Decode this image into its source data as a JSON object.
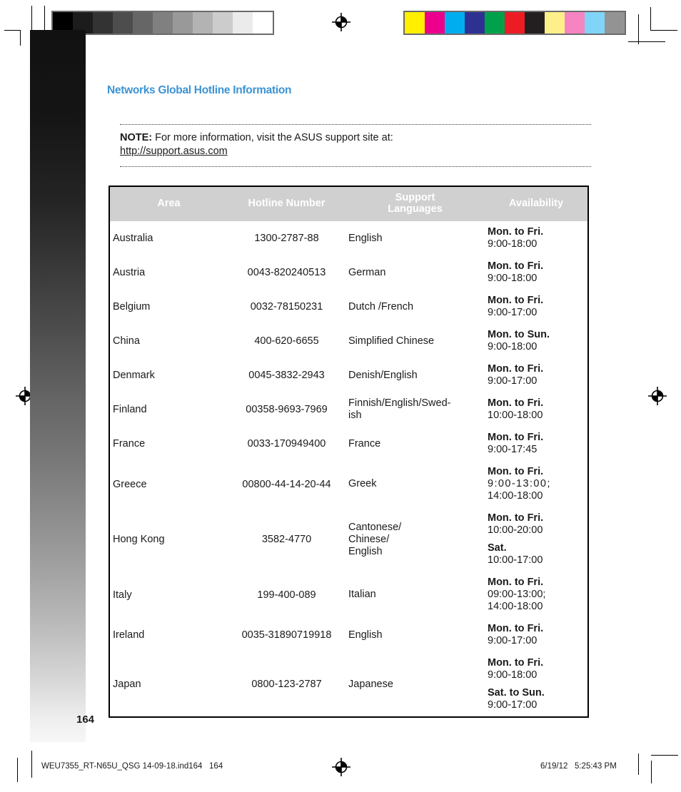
{
  "page": {
    "title": "Networks Global Hotline Information",
    "number": "164",
    "accent_color": "#3c93d4"
  },
  "note": {
    "label": "NOTE:",
    "text": "For more information, visit the ASUS support site at:",
    "url": "http://support.asus.com"
  },
  "table": {
    "headers": {
      "area": "Area",
      "hotline": "Hotline Number",
      "languages_line1": "Support",
      "languages_line2": "Languages",
      "availability": "Availability"
    },
    "rows": [
      {
        "area": "Australia",
        "hotline": "1300-2787-88",
        "languages": [
          "English"
        ],
        "availability": [
          {
            "days": "Mon. to Fri.",
            "hours": "9:00-18:00",
            "spaced": false
          }
        ]
      },
      {
        "area": "Austria",
        "hotline": "0043-820240513",
        "languages": [
          "German"
        ],
        "availability": [
          {
            "days": "Mon. to Fri.",
            "hours": "9:00-18:00",
            "spaced": false
          }
        ]
      },
      {
        "area": "Belgium",
        "hotline": "0032-78150231",
        "languages": [
          "Dutch /French"
        ],
        "availability": [
          {
            "days": "Mon. to Fri.",
            "hours": "9:00-17:00",
            "spaced": false
          }
        ]
      },
      {
        "area": "China",
        "hotline": "400-620-6655",
        "languages": [
          "Simplified Chinese"
        ],
        "availability": [
          {
            "days": "Mon. to Sun.",
            "hours": "9:00-18:00",
            "spaced": false
          }
        ]
      },
      {
        "area": "Denmark",
        "hotline": "0045-3832-2943",
        "languages": [
          "Denish/English"
        ],
        "availability": [
          {
            "days": "Mon. to Fri.",
            "hours": "9:00-17:00",
            "spaced": false
          }
        ]
      },
      {
        "area": "Finland",
        "hotline": "00358-9693-7969",
        "languages": [
          "Finnish/English/Swed-",
          "ish"
        ],
        "availability": [
          {
            "days": "Mon. to Fri.",
            "hours": "10:00-18:00",
            "spaced": false
          }
        ]
      },
      {
        "area": "France",
        "hotline": "0033-170949400",
        "languages": [
          "France"
        ],
        "availability": [
          {
            "days": "Mon. to Fri.",
            "hours": "9:00-17:45",
            "spaced": false
          }
        ]
      },
      {
        "area": "Greece",
        "hotline": "00800-44-14-20-44",
        "languages": [
          "Greek"
        ],
        "availability": [
          {
            "days": "Mon. to Fri.",
            "hours": "9:00-13:00;",
            "spaced": true
          },
          {
            "days": "",
            "hours": "14:00-18:00",
            "spaced": false
          }
        ]
      },
      {
        "area": "Hong Kong",
        "hotline": "3582-4770",
        "languages": [
          "Cantonese/",
          "Chinese/",
          "English"
        ],
        "availability": [
          {
            "days": "Mon. to Fri.",
            "hours": "10:00-20:00",
            "spaced": false
          },
          {
            "days": "Sat.",
            "hours": "10:00-17:00",
            "spaced": false
          }
        ]
      },
      {
        "area": "Italy",
        "hotline": "199-400-089",
        "languages": [
          "Italian"
        ],
        "availability": [
          {
            "days": "Mon. to Fri.",
            "hours": "09:00-13:00;",
            "spaced": false
          },
          {
            "days": "",
            "hours": "14:00-18:00",
            "spaced": false
          }
        ]
      },
      {
        "area": "Ireland",
        "hotline": "0035-31890719918",
        "languages": [
          "English"
        ],
        "availability": [
          {
            "days": "Mon. to Fri.",
            "hours": "9:00-17:00",
            "spaced": false
          }
        ]
      },
      {
        "area": "Japan",
        "hotline": "0800-123-2787",
        "languages": [
          "Japanese"
        ],
        "availability": [
          {
            "days": "Mon. to Fri.",
            "hours": "9:00-18:00",
            "spaced": false
          },
          {
            "days": "Sat. to Sun.",
            "hours": "9:00-17:00",
            "spaced": false
          }
        ]
      }
    ]
  },
  "print_marks": {
    "grayscale_swatches": [
      "#000000",
      "#1c1c1c",
      "#333333",
      "#4d4d4d",
      "#666666",
      "#808080",
      "#999999",
      "#b3b3b3",
      "#cccccc",
      "#ebebeb",
      "#ffffff"
    ],
    "color_swatches": [
      "#fff000",
      "#ec008c",
      "#00aeef",
      "#2e3192",
      "#00a14b",
      "#ed1c24",
      "#231f20",
      "#fdf08a",
      "#f784c2",
      "#7fd4f7",
      "#939393"
    ]
  },
  "footer": {
    "slug_left": "WEU7355_RT-N65U_QSG 14-09-18.ind164   164",
    "slug_right": "6/19/12   5:25:43 PM"
  }
}
